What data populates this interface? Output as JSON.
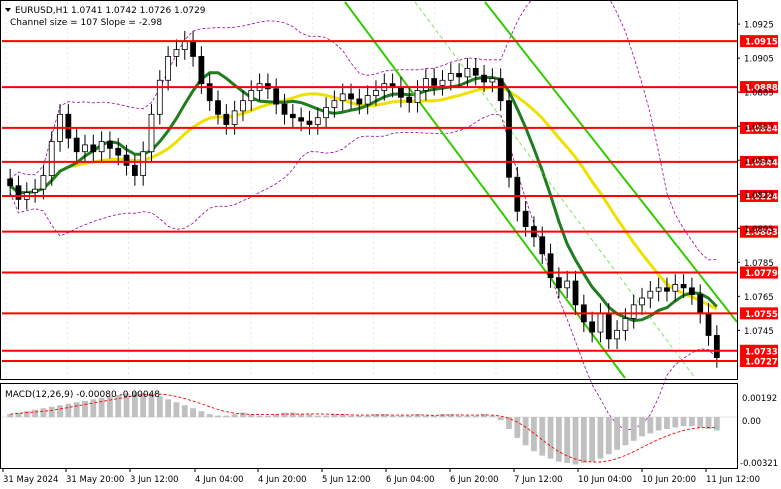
{
  "header": {
    "symbol_line": "EURUSD,H1  1.0741 1.0742 1.0726 1.0729",
    "channel_line": "Channel size = 107 Slope = -2.98"
  },
  "macd": {
    "label": "MACD(12,26,9) -0.00080 -0.00048",
    "ticks": [
      "0.00192",
      "0.00",
      "-0.00321"
    ]
  },
  "colors": {
    "candle": "#000000",
    "support_line": "#ff0000",
    "ma_fast": "#1e7d1e",
    "ma_slow": "#f0e000",
    "channel": "#33cc00",
    "channel_mid": "#66dd33",
    "bands": "#a000a0",
    "macd_hist": "#c0c0c0",
    "macd_signal": "#ff0000",
    "label_bg": "#ff0000"
  },
  "chart_data": {
    "type": "candlestick",
    "symbol": "EURUSD",
    "timeframe": "H1",
    "last_ohlc": {
      "open": 1.0741,
      "high": 1.0742,
      "low": 1.0726,
      "close": 1.0729
    },
    "ylim": [
      1.0717,
      1.0938
    ],
    "price_ticks": [
      "1.0925",
      "1.0905",
      "1.0885",
      "1.0865",
      "1.0845",
      "1.0825",
      "1.0805",
      "1.0785",
      "1.0765",
      "1.0745"
    ],
    "levels": [
      {
        "value": 1.0915,
        "label": "1.0915"
      },
      {
        "value": 1.0888,
        "label": "1.0888"
      },
      {
        "value": 1.0864,
        "label": "1.0864"
      },
      {
        "value": 1.0844,
        "label": "1.0844"
      },
      {
        "value": 1.0824,
        "label": "1.0824"
      },
      {
        "value": 1.0803,
        "label": "1.0803"
      },
      {
        "value": 1.0779,
        "label": "1.0779"
      },
      {
        "value": 1.0755,
        "label": "1.0755"
      },
      {
        "value": 1.0733,
        "label": "1.0733"
      },
      {
        "value": 1.0727,
        "label": "1.0727"
      }
    ],
    "x_labels": [
      "31 May 2024",
      "31 May 20:00",
      "3 Jun 12:00",
      "4 Jun 04:00",
      "4 Jun 20:00",
      "5 Jun 12:00",
      "6 Jun 04:00",
      "6 Jun 20:00",
      "7 Jun 12:00",
      "10 Jun 04:00",
      "10 Jun 20:00",
      "11 Jun 12:00"
    ],
    "closes": [
      1.083,
      1.0822,
      1.0826,
      1.0828,
      1.0836,
      1.0856,
      1.0872,
      1.0858,
      1.085,
      1.0854,
      1.085,
      1.0856,
      1.0852,
      1.0848,
      1.0842,
      1.0836,
      1.085,
      1.0872,
      1.0892,
      1.0906,
      1.091,
      1.0915,
      1.0906,
      1.089,
      1.088,
      1.0872,
      1.0866,
      1.0874,
      1.088,
      1.0886,
      1.089,
      1.0887,
      1.0878,
      1.0872,
      1.087,
      1.0868,
      1.0866,
      1.087,
      1.0876,
      1.088,
      1.0884,
      1.0881,
      1.0878,
      1.0883,
      1.0886,
      1.089,
      1.0888,
      1.0882,
      1.0879,
      1.0886,
      1.0893,
      1.0889,
      1.0892,
      1.0896,
      1.0894,
      1.0899,
      1.0895,
      1.0891,
      1.0893,
      1.088,
      1.0835,
      1.0815,
      1.0806,
      1.08,
      1.079,
      1.0776,
      1.077,
      1.0774,
      1.076,
      1.075,
      1.0744,
      1.0755,
      1.074,
      1.0745,
      1.0752,
      1.076,
      1.0764,
      1.0768,
      1.077,
      1.0768,
      1.0772,
      1.077,
      1.0766,
      1.0755,
      1.0742,
      1.0729
    ],
    "macd_hist": [
      0.0002,
      0.0003,
      0.0004,
      0.0005,
      0.0006,
      0.0007,
      0.0008,
      0.0009,
      0.001,
      0.0011,
      0.0012,
      0.0013,
      0.0014,
      0.0015,
      0.0016,
      0.0017,
      0.0016,
      0.0015,
      0.0014,
      0.0012,
      0.001,
      0.0008,
      0.0006,
      0.0004,
      0.0002,
      0.0001,
      0.0001,
      0.0002,
      0.0003,
      0.0002,
      0.0001,
      0.0001,
      0.0002,
      0.0003,
      0.0003,
      0.0002,
      0.0002,
      0.0001,
      0.0001,
      0.0002,
      0.0002,
      0.0001,
      0.0001,
      0.0001,
      0.0002,
      0.0002,
      0.0001,
      0.0001,
      0.0001,
      0.0002,
      0.0001,
      0.0001,
      0.0002,
      0.0002,
      0.0001,
      0.0001,
      0.0001,
      0.0002,
      0.0001,
      -0.0002,
      -0.0008,
      -0.0014,
      -0.0019,
      -0.0023,
      -0.0026,
      -0.0028,
      -0.003,
      -0.0031,
      -0.0032,
      -0.0031,
      -0.003,
      -0.0028,
      -0.0025,
      -0.0022,
      -0.0019,
      -0.0016,
      -0.0013,
      -0.0011,
      -0.0009,
      -0.0008,
      -0.0007,
      -0.0006,
      -0.0006,
      -0.0007,
      -0.0008,
      -0.0009
    ],
    "macd_ylim": [
      -0.0033,
      0.0021
    ]
  }
}
